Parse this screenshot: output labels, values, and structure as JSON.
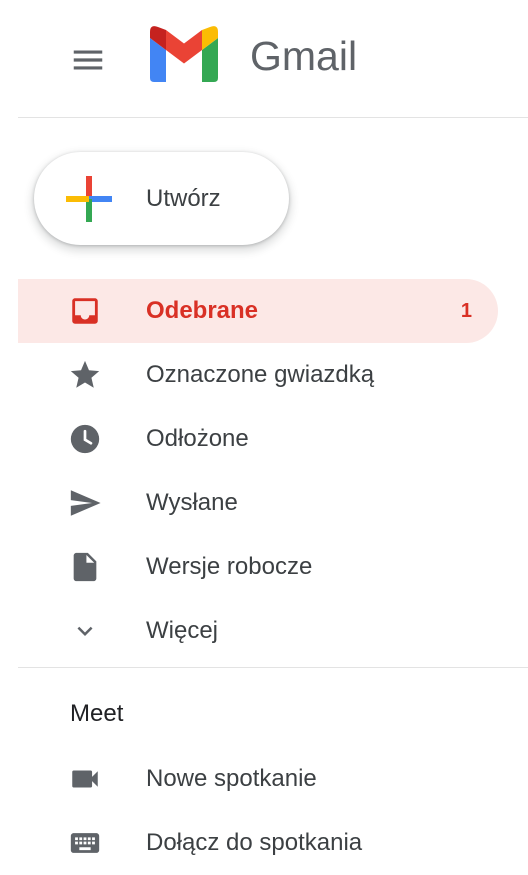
{
  "header": {
    "brand_name": "Gmail"
  },
  "compose": {
    "label": "Utwórz"
  },
  "nav": {
    "items": [
      {
        "label": "Odebrane",
        "icon": "inbox-icon",
        "count": "1",
        "active": true
      },
      {
        "label": "Oznaczone gwiazdką",
        "icon": "star-icon"
      },
      {
        "label": "Odłożone",
        "icon": "clock-icon"
      },
      {
        "label": "Wysłane",
        "icon": "send-icon"
      },
      {
        "label": "Wersje robocze",
        "icon": "draft-icon"
      },
      {
        "label": "Więcej",
        "icon": "chevron-down-icon"
      }
    ]
  },
  "meet": {
    "title": "Meet",
    "items": [
      {
        "label": "Nowe spotkanie",
        "icon": "video-camera-icon"
      },
      {
        "label": "Dołącz do spotkania",
        "icon": "keyboard-icon"
      }
    ]
  },
  "colors": {
    "accent_red": "#d93025",
    "active_background": "#fce8e6",
    "icon_gray": "#5f6368",
    "text_gray": "#3c4043"
  }
}
